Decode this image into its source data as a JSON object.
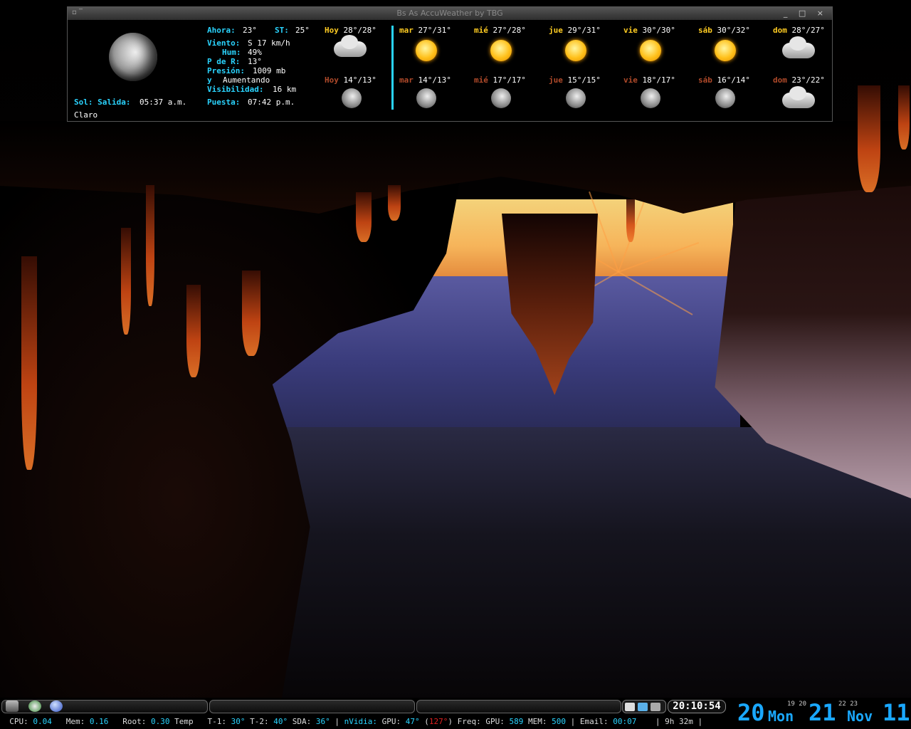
{
  "window": {
    "title": "Bs As AccuWeather by TBG",
    "controls": "_ □ ×"
  },
  "current": {
    "now_label": "Ahora:",
    "now_value": "23°",
    "feels_label": "ST:",
    "feels_value": "25°",
    "wind_label": "Viento:",
    "wind_value": "S 17 km/h",
    "hum_label": "Hum:",
    "hum_value": "49%",
    "dew_label": "P de R:",
    "dew_value": "13°",
    "pressure_label": "Presión:",
    "pressure_value": "1009 mb",
    "trend_label": "y",
    "trend_value": "Aumentando",
    "visibility_label": "Visibilidad:",
    "visibility_value": "16 km",
    "sunrise_label": "Sol: Salida:",
    "sunrise_value": "05:37 a.m.",
    "sunset_label": "Puesta:",
    "sunset_value": "07:42 p.m.",
    "condition": "Claro"
  },
  "forecast_day": [
    {
      "day": "Hoy",
      "temps": "28°/28°",
      "icon": "partly-cloudy-icon"
    },
    {
      "day": "mar",
      "temps": "27°/31°",
      "icon": "sun-icon"
    },
    {
      "day": "mié",
      "temps": "27°/28°",
      "icon": "sun-icon"
    },
    {
      "day": "jue",
      "temps": "29°/31°",
      "icon": "sun-cloud-icon"
    },
    {
      "day": "vie",
      "temps": "30°/30°",
      "icon": "sun-cloud-icon"
    },
    {
      "day": "sáb",
      "temps": "30°/32°",
      "icon": "sun-icon"
    },
    {
      "day": "dom",
      "temps": "28°/27°",
      "icon": "cloudy-icon"
    }
  ],
  "forecast_night": [
    {
      "day": "Hoy",
      "temps": "14°/13°",
      "icon": "moon-cloud-icon"
    },
    {
      "day": "mar",
      "temps": "14°/13°",
      "icon": "moon-cloud-icon"
    },
    {
      "day": "mié",
      "temps": "17°/17°",
      "icon": "moon-cloud-icon"
    },
    {
      "day": "jue",
      "temps": "15°/15°",
      "icon": "moon-cloud-icon"
    },
    {
      "day": "vie",
      "temps": "18°/17°",
      "icon": "moon-cloud-icon"
    },
    {
      "day": "sáb",
      "temps": "16°/14°",
      "icon": "moon-icon"
    },
    {
      "day": "dom",
      "temps": "23°/22°",
      "icon": "cloudy-icon"
    }
  ],
  "panel": {
    "clock": "20:10:54",
    "status": {
      "cpu_label": "CPU:",
      "cpu": "0.04",
      "mem_label": "Mem:",
      "mem": "0.16",
      "root_label": "Root:",
      "root": "0.30",
      "temp_label": "Temp",
      "t1_label": "T-1:",
      "t1": "30°",
      "t2_label": "T-2:",
      "t2": "40°",
      "sda_label": "SDA:",
      "sda": "36°",
      "nvidia_label": "nVidia:",
      "gpu_label": "GPU:",
      "gpu": "47°",
      "gpu_paren": "127°",
      "freq_label": ") Freq:",
      "gpufreq_label": "GPU:",
      "gpufreq": "589",
      "memfreq_label": "MEM:",
      "memfreq": "500",
      "email_label": "Email:",
      "email": "00:07",
      "uptime": "9h 32m"
    },
    "date": {
      "day_num": "20",
      "weekday": "Mon",
      "small_time": "19 20",
      "mid_num": "21",
      "small_time2": "22 23",
      "month": "Nov",
      "year": "11"
    }
  }
}
